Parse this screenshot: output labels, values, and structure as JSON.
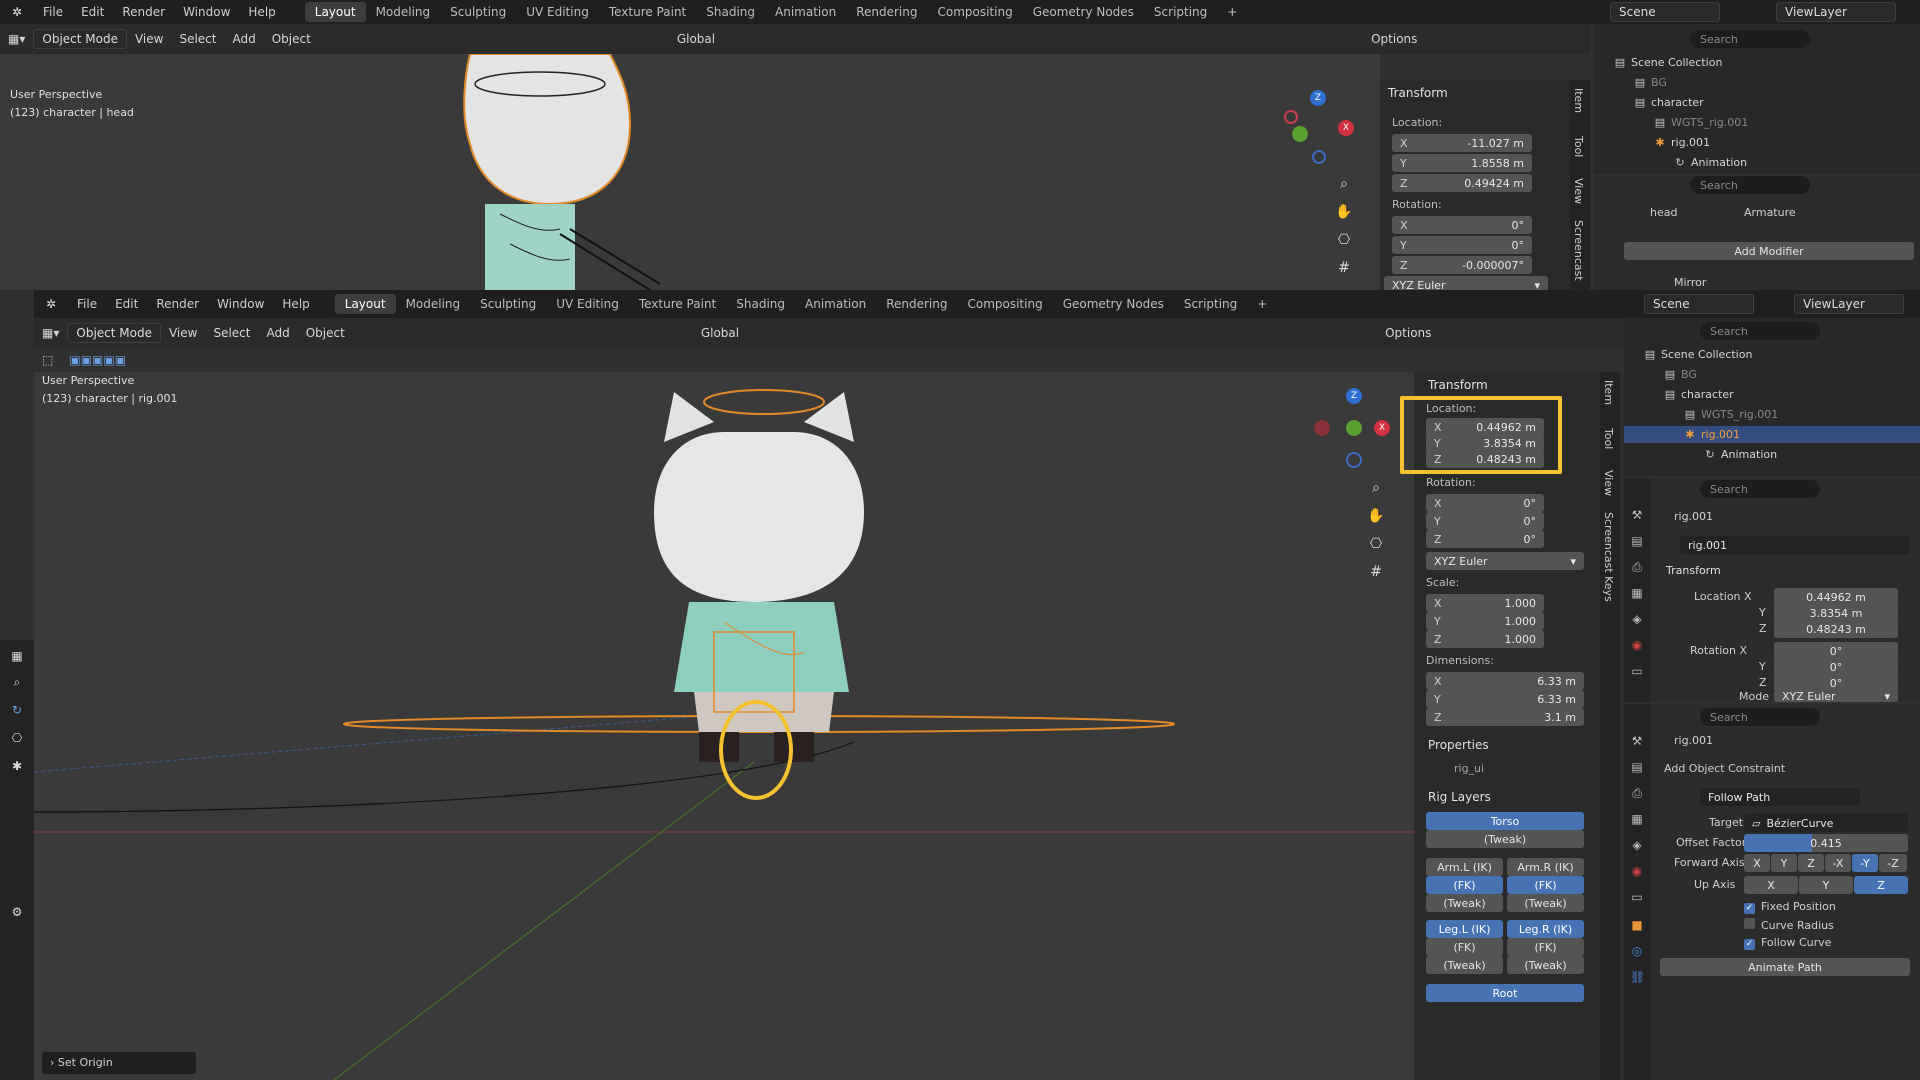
{
  "top": {
    "menu": [
      "File",
      "Edit",
      "Render",
      "Window",
      "Help"
    ],
    "tabs": [
      "Layout",
      "Modeling",
      "Sculpting",
      "UV Editing",
      "Texture Paint",
      "Shading",
      "Animation",
      "Rendering",
      "Compositing",
      "Geometry Nodes",
      "Scripting"
    ],
    "plus": "+",
    "scene": "Scene",
    "viewlayer": "ViewLayer",
    "mode": "Object Mode",
    "view": "View",
    "select": "Select",
    "add": "Add",
    "object": "Object",
    "orient": "Global",
    "options": "Options",
    "persp": "User Perspective",
    "sel": "(123) character | head",
    "transform": "Transform",
    "location": "Location:",
    "loc": [
      {
        "a": "X",
        "v": "-11.027 m"
      },
      {
        "a": "Y",
        "v": "1.8558 m"
      },
      {
        "a": "Z",
        "v": "0.49424 m"
      }
    ],
    "rotation": "Rotation:",
    "rot": [
      {
        "a": "X",
        "v": "0°"
      },
      {
        "a": "Y",
        "v": "0°"
      },
      {
        "a": "Z",
        "v": "-0.000007°"
      }
    ],
    "euler": "XYZ Euler",
    "search": "Search",
    "outliner": [
      {
        "t": "Scene Collection"
      },
      {
        "t": "BG"
      },
      {
        "t": "character"
      },
      {
        "t": "WGTS_rig.001"
      },
      {
        "t": "rig.001"
      },
      {
        "t": "Animation"
      }
    ],
    "crumb1": "head",
    "crumb2": "Armature",
    "addmod": "Add Modifier",
    "mirror": "Mirror",
    "sidetabs": [
      "Item",
      "Tool",
      "View",
      "Screencast"
    ]
  },
  "main": {
    "menu": [
      "File",
      "Edit",
      "Render",
      "Window",
      "Help"
    ],
    "tabs": [
      "Layout",
      "Modeling",
      "Sculpting",
      "UV Editing",
      "Texture Paint",
      "Shading",
      "Animation",
      "Rendering",
      "Compositing",
      "Geometry Nodes",
      "Scripting"
    ],
    "plus": "+",
    "scene": "Scene",
    "viewlayer": "ViewLayer",
    "mode": "Object Mode",
    "view": "View",
    "select": "Select",
    "add": "Add",
    "object": "Object",
    "orient": "Global",
    "options": "Options",
    "persp": "User Perspective",
    "sel": "(123) character | rig.001",
    "transform": "Transform",
    "location": "Location:",
    "loc": [
      {
        "a": "X",
        "v": "0.44962 m"
      },
      {
        "a": "Y",
        "v": "3.8354 m"
      },
      {
        "a": "Z",
        "v": "0.48243 m"
      }
    ],
    "rotation": "Rotation:",
    "rot": [
      {
        "a": "X",
        "v": "0°"
      },
      {
        "a": "Y",
        "v": "0°"
      },
      {
        "a": "Z",
        "v": "0°"
      }
    ],
    "euler": "XYZ Euler",
    "scale": "Scale:",
    "scl": [
      {
        "a": "X",
        "v": "1.000"
      },
      {
        "a": "Y",
        "v": "1.000"
      },
      {
        "a": "Z",
        "v": "1.000"
      }
    ],
    "dimensions": "Dimensions:",
    "dim": [
      {
        "a": "X",
        "v": "6.33 m"
      },
      {
        "a": "Y",
        "v": "6.33 m"
      },
      {
        "a": "Z",
        "v": "3.1 m"
      }
    ],
    "properties": "Properties",
    "rig_ui": "rig_ui",
    "riglayers": "Rig Layers",
    "rl": {
      "torso": "Torso",
      "tweak": "(Tweak)",
      "arml": "Arm.L (IK)",
      "armr": "Arm.R (IK)",
      "fk": "(FK)",
      "tw": "(Tweak)",
      "legl": "Leg.L (IK)",
      "legr": "Leg.R (IK)",
      "root": "Root"
    },
    "sidetabs": [
      "Item",
      "Tool",
      "View",
      "Screencast Keys"
    ],
    "setorigin": "Set Origin",
    "outliner": [
      {
        "t": "Scene Collection"
      },
      {
        "t": "BG"
      },
      {
        "t": "character"
      },
      {
        "t": "WGTS_rig.001"
      },
      {
        "t": "rig.001"
      },
      {
        "t": "Animation"
      }
    ],
    "search": "Search",
    "objname": "rig.001",
    "dataname": "rig.001",
    "ptransform": "Transform",
    "plx": "Location X",
    "ply": "Y",
    "plz": "Z",
    "plv": [
      "0.44962 m",
      "3.8354 m",
      "0.48243 m"
    ],
    "prx": "Rotation X",
    "pry": "Y",
    "prz": "Z",
    "prv": [
      "0°",
      "0°",
      "0°"
    ],
    "mode_lbl": "Mode",
    "mode_val": "XYZ Euler",
    "con_obj": "rig.001",
    "addcon": "Add Object Constraint",
    "followpath": "Follow Path",
    "target": "Target",
    "target_val": "BézierCurve",
    "offset": "Offset Factor",
    "offset_val": "0.415",
    "fwd": "Forward Axis",
    "fwd_opts": [
      "X",
      "Y",
      "Z",
      "-X",
      "-Y",
      "-Z"
    ],
    "up": "Up Axis",
    "up_opts": [
      "X",
      "Y",
      "Z"
    ],
    "fixed": "Fixed Position",
    "radius": "Curve Radius",
    "follow": "Follow Curve",
    "animpath": "Animate Path"
  }
}
